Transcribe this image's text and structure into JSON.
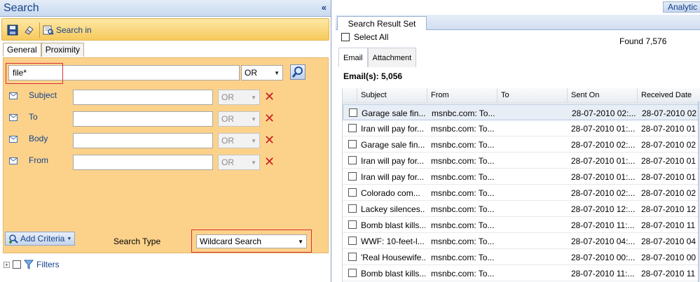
{
  "left": {
    "title": "Search",
    "collapse_label": "«",
    "toolbar": {
      "search_in_label": "Search in"
    },
    "tabs": [
      {
        "label": "General"
      },
      {
        "label": "Proximity"
      }
    ],
    "form": {
      "main_value": "file*",
      "main_operator": "OR",
      "criteria": [
        {
          "label": "Subject",
          "operator": "OR"
        },
        {
          "label": "To",
          "operator": "OR"
        },
        {
          "label": "Body",
          "operator": "OR"
        },
        {
          "label": "From",
          "operator": "OR"
        }
      ],
      "add_criteria_label": "Add Criteria",
      "search_type_label": "Search Type",
      "search_type_value": "Wildcard Search"
    },
    "filters_label": "Filters"
  },
  "right": {
    "analytics_label": "Analytic",
    "result_tab_label": "Search Result Set",
    "select_all_label": "Select All",
    "found_text": "Found 7,576",
    "sub_tabs": [
      {
        "label": "Email"
      },
      {
        "label": "Attachment"
      }
    ],
    "emails_count": "Email(s):  5,056",
    "columns": [
      "Subject",
      "From",
      "To",
      "Sent On",
      "Received Date"
    ],
    "rows": [
      {
        "subject": "Garage sale fin...",
        "from": "msnbc.com: To...",
        "to": "",
        "sent": "28-07-2010 02:...",
        "received": "28-07-2010 02"
      },
      {
        "subject": "Iran will pay for...",
        "from": "msnbc.com: To...",
        "to": "",
        "sent": "28-07-2010 01:...",
        "received": "28-07-2010 01"
      },
      {
        "subject": "Garage sale fin...",
        "from": "msnbc.com: To...",
        "to": "",
        "sent": "28-07-2010 02:...",
        "received": "28-07-2010 02"
      },
      {
        "subject": "Iran will pay for...",
        "from": "msnbc.com: To...",
        "to": "",
        "sent": "28-07-2010 01:...",
        "received": "28-07-2010 01"
      },
      {
        "subject": "Iran will pay for...",
        "from": "msnbc.com: To...",
        "to": "",
        "sent": "28-07-2010 01:...",
        "received": "28-07-2010 01"
      },
      {
        "subject": "Colorado com...",
        "from": "msnbc.com: To...",
        "to": "",
        "sent": "28-07-2010 02:...",
        "received": "28-07-2010 02"
      },
      {
        "subject": "Lackey silences...",
        "from": "msnbc.com: To...",
        "to": "",
        "sent": "28-07-2010 12:...",
        "received": "28-07-2010 12"
      },
      {
        "subject": "Bomb blast kills...",
        "from": "msnbc.com: To...",
        "to": "",
        "sent": "28-07-2010 11:...",
        "received": "28-07-2010 11"
      },
      {
        "subject": "WWF: 10-feet-l...",
        "from": "msnbc.com: To...",
        "to": "",
        "sent": "28-07-2010 04:...",
        "received": "28-07-2010 04"
      },
      {
        "subject": "'Real Housewife...",
        "from": "msnbc.com: To...",
        "to": "",
        "sent": "28-07-2010 00:...",
        "received": "28-07-2010 00"
      },
      {
        "subject": "Bomb blast kills...",
        "from": "msnbc.com: To...",
        "to": "",
        "sent": "28-07-2010 11:...",
        "received": "28-07-2010 11"
      }
    ]
  }
}
